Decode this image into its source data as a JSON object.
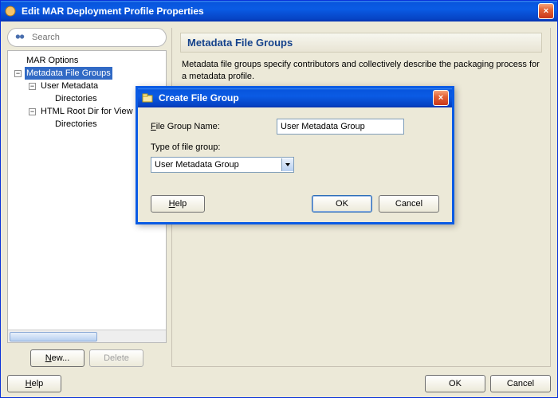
{
  "window": {
    "title": "Edit MAR Deployment Profile Properties",
    "close_glyph": "×"
  },
  "search": {
    "placeholder": "Search"
  },
  "tree": {
    "items": [
      {
        "label": "MAR Options",
        "indent": 0,
        "expander": "none",
        "selected": false
      },
      {
        "label": "Metadata File Groups",
        "indent": 0,
        "expander": "minus",
        "selected": true
      },
      {
        "label": "User Metadata",
        "indent": 1,
        "expander": "minus",
        "selected": false
      },
      {
        "label": "Directories",
        "indent": 2,
        "expander": "none",
        "selected": false
      },
      {
        "label": "HTML Root Dir for View",
        "indent": 1,
        "expander": "minus",
        "selected": false
      },
      {
        "label": "Directories",
        "indent": 2,
        "expander": "none",
        "selected": false
      }
    ]
  },
  "sidebar_buttons": {
    "new": "New...",
    "delete": "Delete"
  },
  "panel": {
    "title": "Metadata File Groups",
    "description": "Metadata file groups specify contributors and collectively describe the packaging process for a metadata profile."
  },
  "bottom": {
    "help": "Help",
    "ok": "OK",
    "cancel": "Cancel"
  },
  "modal": {
    "title": "Create File Group",
    "close_glyph": "×",
    "name_label": "File Group Name:",
    "name_value": "User Metadata Group",
    "type_label": "Type of file group:",
    "type_value": "User Metadata Group",
    "help": "Help",
    "ok": "OK",
    "cancel": "Cancel"
  }
}
